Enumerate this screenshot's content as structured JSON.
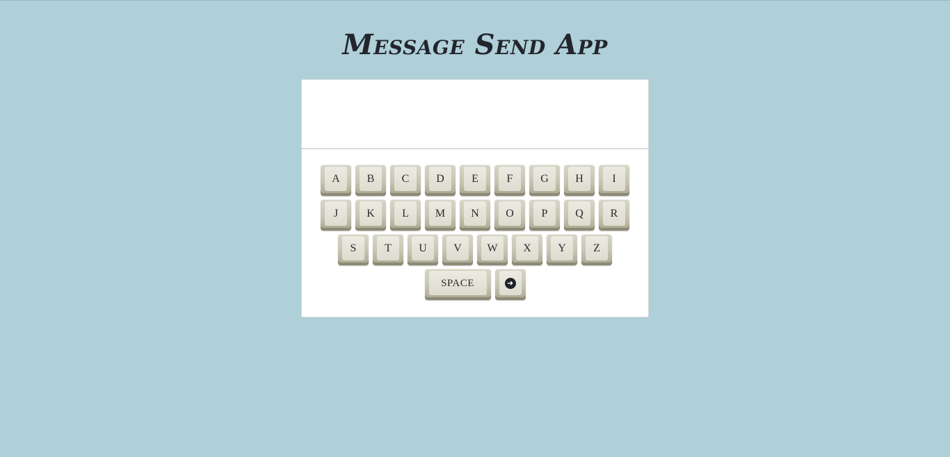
{
  "app": {
    "title": "Message Send App"
  },
  "message": {
    "value": ""
  },
  "keyboard": {
    "row1": [
      "A",
      "B",
      "C",
      "D",
      "E",
      "F",
      "G",
      "H",
      "I"
    ],
    "row2": [
      "J",
      "K",
      "L",
      "M",
      "N",
      "O",
      "P",
      "Q",
      "R"
    ],
    "row3": [
      "S",
      "T",
      "U",
      "V",
      "W",
      "X",
      "Y",
      "Z"
    ],
    "space_label": "SPACE",
    "send_icon": "arrow-circle-right-icon"
  },
  "colors": {
    "background": "#afcfd9",
    "title": "#22252b",
    "panel": "#ffffff",
    "key_face": "#dedccf"
  }
}
